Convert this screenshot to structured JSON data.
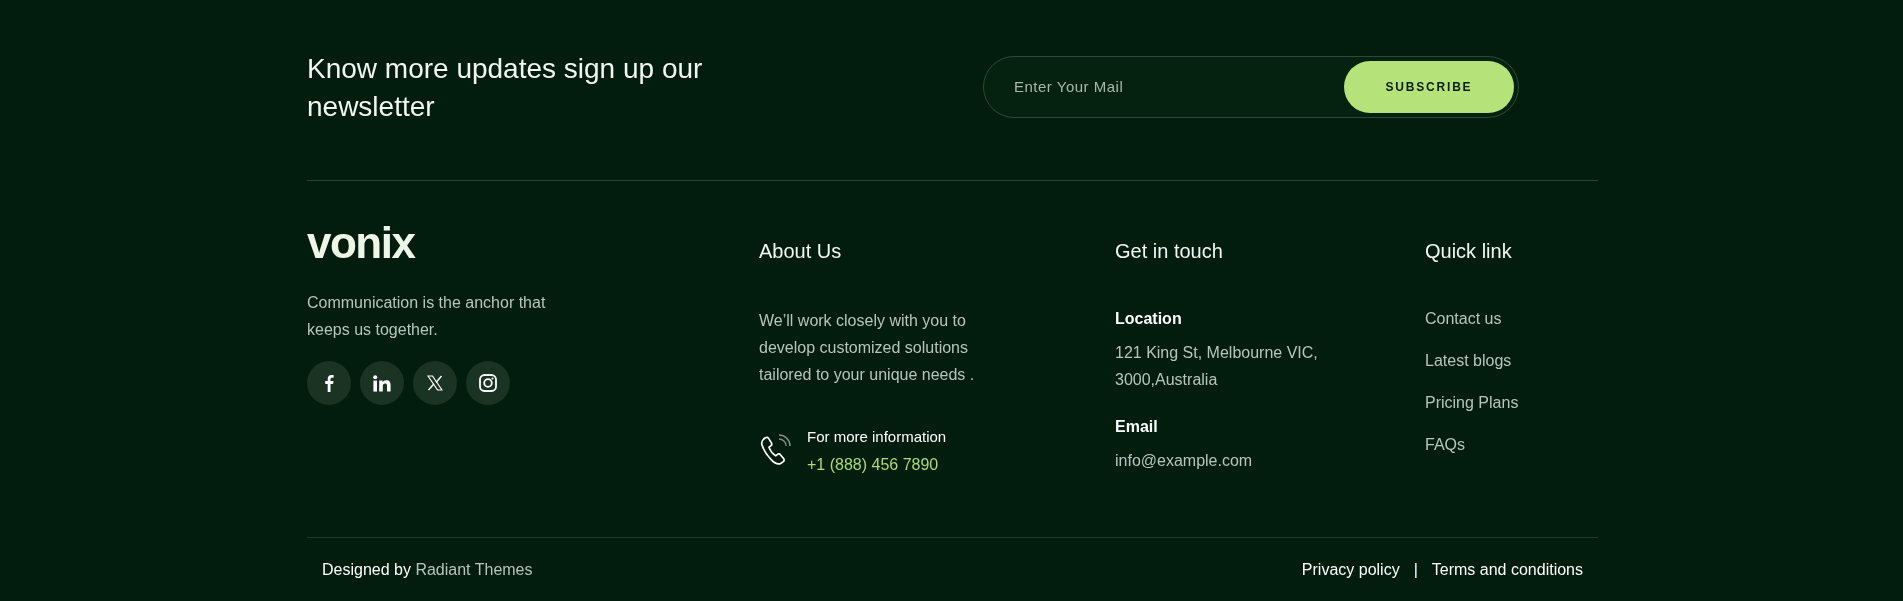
{
  "newsletter": {
    "heading": "Know more updates sign up our newsletter",
    "email": {
      "placeholder": "Enter Your Mail"
    },
    "button": "SUBSCRIBE"
  },
  "brand": {
    "logo": "vonix",
    "tagline": "Communication is the anchor that keeps us together."
  },
  "about": {
    "heading": "About Us",
    "text": "We’ll work closely with you to develop customized solutions tailored to your unique needs .",
    "contact_label": "For more information",
    "phone": "+1 (888) 456 7890"
  },
  "contact": {
    "heading": "Get in touch",
    "items": [
      {
        "label": "Location",
        "value": "121 King St, Melbourne VIC, 3000,Australia"
      },
      {
        "label": "Email",
        "value": "info@example.com"
      }
    ]
  },
  "quick_links": {
    "heading": "Quick link",
    "links": [
      "Contact us",
      "Latest blogs",
      "Pricing Plans",
      "FAQs"
    ]
  },
  "bottom_bar": {
    "credit_prefix": "Designed by",
    "credit_link": "Radiant Themes",
    "links": [
      "Privacy policy",
      "Terms and conditions"
    ],
    "separator": "|"
  }
}
